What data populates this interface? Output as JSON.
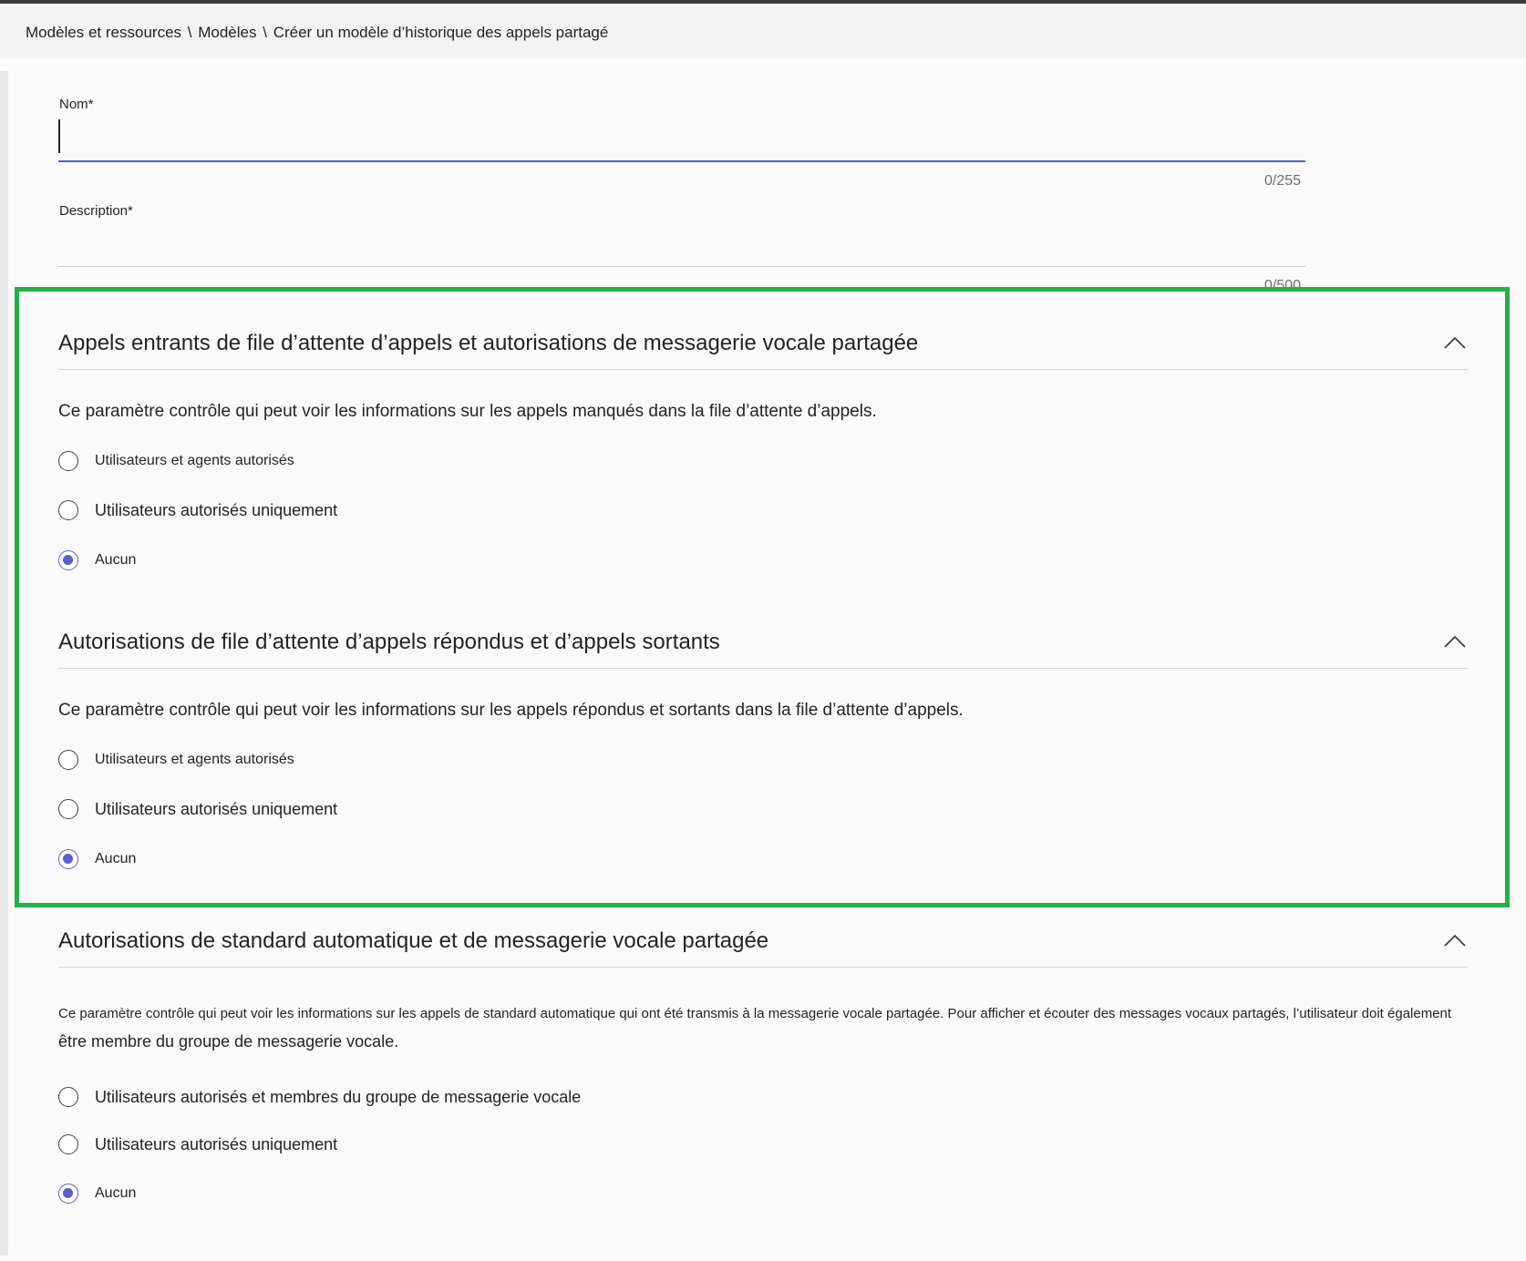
{
  "breadcrumb": {
    "items": [
      "Modèles et ressources",
      "Modèles",
      "Créer un modèle d’historique des appels partagé"
    ],
    "separator": "\\"
  },
  "form": {
    "name_label": "Nom*",
    "name_value": "",
    "name_counter": "0/255",
    "description_label": "Description*",
    "description_value": "",
    "description_counter": "0/500"
  },
  "sections": [
    {
      "title": "Appels entrants de file d’attente d’appels et autorisations de messagerie vocale partagée",
      "description": "Ce paramètre contrôle qui peut voir les informations sur les appels manqués dans la file d’attente d’appels.",
      "options": [
        "Utilisateurs et agents autorisés",
        "Utilisateurs autorisés uniquement",
        "Aucun"
      ],
      "selected": "Aucun",
      "expanded": true
    },
    {
      "title": "Autorisations de file d’attente d’appels répondus et d’appels sortants",
      "description": "Ce paramètre contrôle qui peut voir les informations sur les appels répondus et sortants dans la file d’attente d’appels.",
      "options": [
        "Utilisateurs et agents autorisés",
        "Utilisateurs autorisés uniquement",
        "Aucun"
      ],
      "selected": "Aucun",
      "expanded": true
    },
    {
      "title": "Autorisations de standard automatique et de messagerie vocale partagée",
      "description_line1": "Ce paramètre contrôle qui peut voir les informations sur les appels de standard automatique qui ont été transmis à la messagerie vocale partagée. Pour afficher et écouter des messages vocaux partagés, l’utilisateur doit également",
      "description_line2": "être membre du groupe de messagerie vocale.",
      "options": [
        "Utilisateurs autorisés et membres du groupe de messagerie vocale",
        "Utilisateurs autorisés uniquement",
        "Aucun"
      ],
      "selected": "Aucun",
      "expanded": true
    }
  ],
  "colors": {
    "accent": "#5b5fc7",
    "highlight_border": "#22b04a"
  },
  "icons": {
    "collapse": "chevron-up-icon"
  }
}
